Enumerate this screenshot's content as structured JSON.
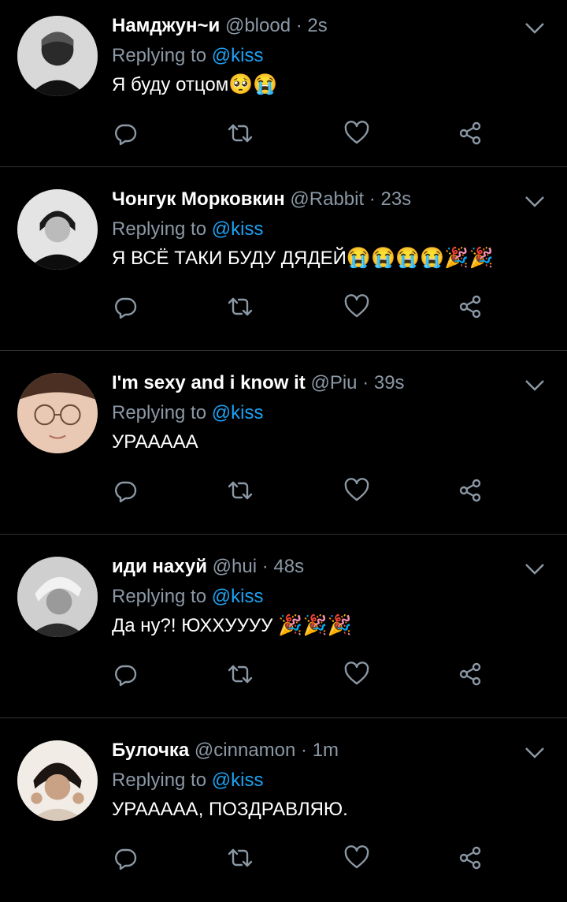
{
  "replying_label": "Replying to",
  "tweets": [
    {
      "name": "Намджун~и",
      "handle": "@blood",
      "time": "· 2s",
      "mention": "@kiss",
      "text": "Я буду отцом",
      "emoji": "🥺😭"
    },
    {
      "name": "Чонгук Морковкин",
      "handle": "@Rabbit",
      "time": "· 23s",
      "mention": "@kiss",
      "text": "Я ВСЁ ТАКИ БУДУ ДЯДЕЙ",
      "emoji": "😭😭😭😭🎉🎉"
    },
    {
      "name": "I'm sexy and i know it",
      "handle": "@Piu",
      "time": "· 39s",
      "mention": "@kiss",
      "text": "УРААААА",
      "emoji": ""
    },
    {
      "name": "иди нахуй",
      "handle": "@hui",
      "time": "· 48s",
      "mention": "@kiss",
      "text": "Да ну?! ЮХХУУУУ",
      "emoji": " 🎉🎉🎉"
    },
    {
      "name": "Булочка",
      "handle": "@cinnamon",
      "time": "· 1m",
      "mention": "@kiss",
      "text": "УРААААА, ПОЗДРАВЛЯЮ.",
      "emoji": ""
    }
  ],
  "colors": {
    "background": "#000000",
    "secondary": "#8b98a5",
    "accent": "#1da1f2",
    "divider": "#2f3336"
  }
}
